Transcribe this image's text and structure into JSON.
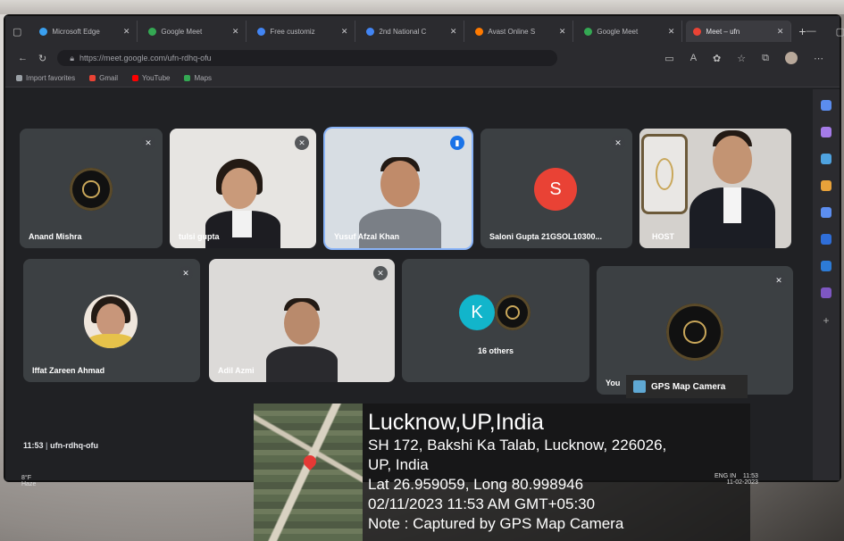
{
  "browser": {
    "tabs": [
      {
        "label": "Microsoft Edge",
        "color": "#3aa0f0",
        "active": false
      },
      {
        "label": "Google Meet",
        "color": "#34a853",
        "active": false
      },
      {
        "label": "Free customiz",
        "color": "#4285f4",
        "active": false
      },
      {
        "label": "2nd National C",
        "color": "#4285f4",
        "active": false
      },
      {
        "label": "Avast Online S",
        "color": "#ff7a00",
        "active": false
      },
      {
        "label": "Google Meet",
        "color": "#34a853",
        "active": false
      },
      {
        "label": "Meet – ufn",
        "color": "#ea4335",
        "active": true
      }
    ],
    "new_tab": "+",
    "url": "https://meet.google.com/ufn-rdhq-ofu",
    "bookmarks": [
      {
        "label": "Import favorites",
        "color": "#9aa0a6"
      },
      {
        "label": "Gmail",
        "color": "#ea4335"
      },
      {
        "label": "YouTube",
        "color": "#ff0000"
      },
      {
        "label": "Maps",
        "color": "#34a853"
      }
    ]
  },
  "meet": {
    "participants": [
      {
        "name": "Anand Mishra",
        "kind": "logo"
      },
      {
        "name": "tulsi gupta",
        "kind": "video-woman"
      },
      {
        "name": "Yusuf Afzal Khan",
        "kind": "video-man",
        "speaking": true
      },
      {
        "name": "Saloni Gupta 21GSOL10300...",
        "kind": "initial",
        "initial": "S",
        "color": "#e94235"
      },
      {
        "name": "HOST",
        "kind": "video-host"
      },
      {
        "name": "Iffat Zareen Ahmad",
        "kind": "photo"
      },
      {
        "name": "Adil Azmi",
        "kind": "video-man2"
      },
      {
        "name": "16 others",
        "kind": "group",
        "initial": "K",
        "color": "#12b5cb"
      },
      {
        "name": "You",
        "kind": "logo"
      }
    ],
    "meeting_time": "11:53",
    "meeting_code": "ufn-rdhq-ofu"
  },
  "weather": {
    "temp": "8°F",
    "condition": "Haze"
  },
  "gps": {
    "app_label": "GPS Map Camera",
    "title": "Lucknow,UP,India",
    "address1": "SH 172, Bakshi Ka Talab, Lucknow, 226026,",
    "address2": "UP, India",
    "coords": "Lat 26.959059, Long 80.998946",
    "datetime": "02/11/2023 11:53 AM GMT+05:30",
    "note": "Note : Captured by GPS Map Camera"
  },
  "taskbar": {
    "lang": "ENG",
    "region": "IN",
    "time": "11:53",
    "date": "11-02-2023"
  }
}
